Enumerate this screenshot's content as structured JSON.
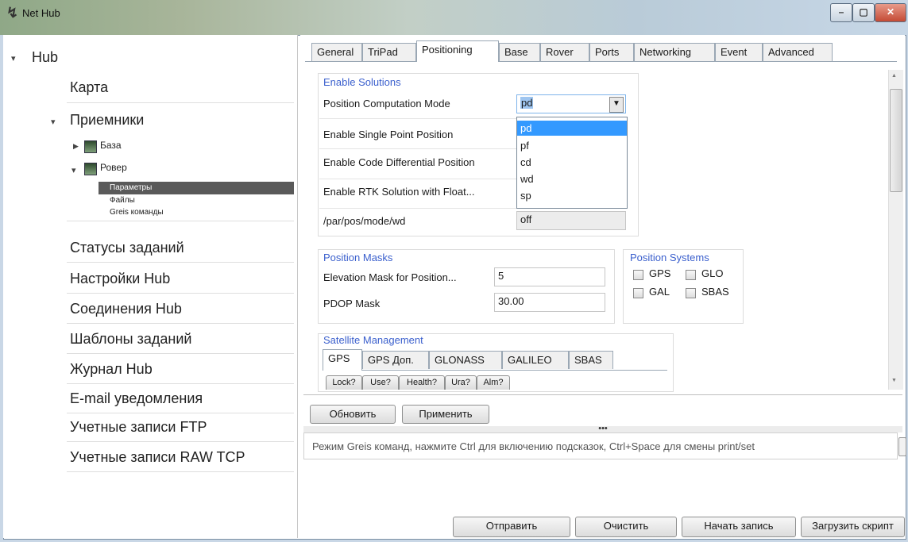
{
  "window": {
    "title": "Net Hub"
  },
  "sidebar": {
    "root": "Hub",
    "items": {
      "karta": "Карта",
      "priemniki": "Приемники",
      "baza": "База",
      "rover": "Ровер",
      "parametry": "Параметры",
      "faily": "Файлы",
      "greis": "Greis команды",
      "statusy": "Статусы заданий",
      "nastroiki": "Настройки Hub",
      "soedineniya": "Соединения Hub",
      "shablony": "Шаблоны заданий",
      "zhurnal": "Журнал Hub",
      "email": "E-mail уведомления",
      "ftp": "Учетные записи FTP",
      "rawtcp": "Учетные записи RAW TCP"
    }
  },
  "tabs": [
    "General",
    "TriPad",
    "Positioning",
    "Base",
    "Rover",
    "Ports",
    "Networking",
    "Event",
    "Advanced"
  ],
  "enable_solutions": {
    "title": "Enable Solutions",
    "rows": [
      {
        "label": "Position Computation Mode",
        "value": "pd"
      },
      {
        "label": "Enable Single Point Position",
        "value": ""
      },
      {
        "label": "Enable Code Differential Position",
        "value": ""
      },
      {
        "label": "Enable RTK Solution with Float...",
        "value": ""
      },
      {
        "label": "/par/pos/mode/wd",
        "value": "off"
      }
    ],
    "dropdown_options": [
      "pd",
      "pf",
      "cd",
      "wd",
      "sp"
    ]
  },
  "position_masks": {
    "title": "Position Masks",
    "rows": [
      {
        "label": "Elevation Mask for Position...",
        "value": "5"
      },
      {
        "label": "PDOP Mask",
        "value": "30.00"
      }
    ]
  },
  "position_systems": {
    "title": "Position Systems",
    "items": [
      "GPS",
      "GLO",
      "GAL",
      "SBAS"
    ]
  },
  "satellite_management": {
    "title": "Satellite Management",
    "tabs": [
      "GPS",
      "GPS Доп.",
      "GLONASS",
      "GALILEO",
      "SBAS"
    ],
    "columns": [
      "Lock?",
      "Use?",
      "Health?",
      "Ura?",
      "Alm?"
    ]
  },
  "buttons": {
    "refresh": "Обновить",
    "apply": "Применить",
    "send": "Отправить",
    "clear": "Очистить",
    "record": "Начать запись",
    "load_script": "Загрузить скрипт"
  },
  "console": {
    "hint": "Режим Greis команд, нажмите  Ctrl для включению подсказок, Ctrl+Space для смены print/set"
  },
  "splitter": "•••"
}
